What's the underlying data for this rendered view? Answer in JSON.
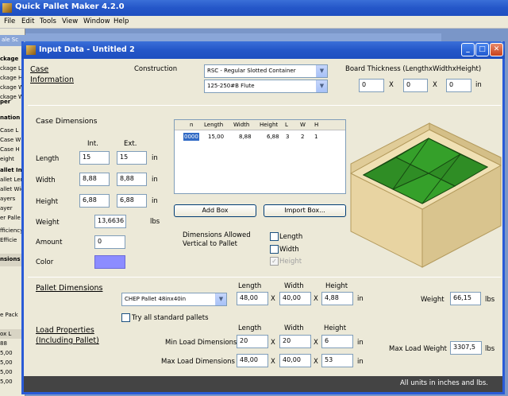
{
  "app": {
    "title": "Quick Pallet Maker 4.2.0",
    "menu": [
      "File",
      "Edit",
      "Tools",
      "View",
      "Window",
      "Help"
    ]
  },
  "bg": {
    "left_texts": [
      "ale Sc",
      "ckage",
      "ckage L",
      "ckage H",
      "ckage W",
      "ckage W",
      "per",
      "nation",
      "Case L",
      "Case W",
      "Case H",
      "eight",
      "allet Inf",
      "allet Len",
      "allet Wid",
      "ayers",
      "ayer",
      "er Palle",
      "fficiency",
      "Efficie",
      "nsions",
      "e Pack",
      "ox L",
      "88",
      "5,00",
      "5,00",
      "5,00",
      "5,00"
    ]
  },
  "dialog": {
    "title": "Input Data - Untitled 2",
    "case_info": {
      "label1": "Case",
      "label2": "Information",
      "construction_label": "Construction",
      "construction_value": "RSC - Regular Slotted Container",
      "flute_value": "125-250#B Flute",
      "board_label": "Board Thickness (LengthxWidthxHeight)",
      "board": [
        "0",
        "0",
        "0"
      ],
      "x": "X",
      "unit": "in"
    },
    "case_dim": {
      "title": "Case Dimensions",
      "int": "Int.",
      "ext": "Ext.",
      "length": "Length",
      "width": "Width",
      "height": "Height",
      "weight": "Weight",
      "amount": "Amount",
      "color": "Color",
      "len_int": "15",
      "len_ext": "15",
      "wid_int": "8,88",
      "wid_ext": "8,88",
      "hgt_int": "6,88",
      "hgt_ext": "6,88",
      "weight_val": "13,6636",
      "amount_val": "0",
      "in": "in",
      "lbs": "lbs"
    },
    "table": {
      "headers": [
        "n",
        "Length",
        "Width",
        "Height",
        "L",
        "W",
        "H"
      ],
      "row": [
        "0000",
        "15,00",
        "8,88",
        "6,88",
        "3",
        "2",
        "1"
      ]
    },
    "buttons": {
      "add": "Add Box",
      "import": "Import Box..."
    },
    "vertical": {
      "label1": "Dimensions Allowed",
      "label2": "Vertical to Pallet",
      "length": "Length",
      "width": "Width",
      "height": "Height",
      "check": "✓"
    },
    "pallet": {
      "label": "Pallet Dimensions",
      "value": "CHEP Pallet 48inx40in",
      "length_h": "Length",
      "width_h": "Width",
      "height_h": "Height",
      "length": "48,00",
      "width": "40,00",
      "height": "4,88",
      "x": "X",
      "in": "in",
      "weight_label": "Weight",
      "weight": "66,15",
      "lbs": "lbs",
      "try_all": "Try all standard pallets"
    },
    "load": {
      "label1": "Load Properties",
      "label2": "(Including Pallet)",
      "length_h": "Length",
      "width_h": "Width",
      "height_h": "Height",
      "min_label": "Min Load Dimensions",
      "max_label": "Max Load Dimensions",
      "min": [
        "20",
        "20",
        "6"
      ],
      "max": [
        "48,00",
        "40,00",
        "53"
      ],
      "x": "X",
      "in": "in",
      "max_weight_label": "Max Load Weight",
      "max_weight": "3307,5",
      "lbs": "lbs"
    },
    "footer": "All units in inches and lbs."
  },
  "colors": {
    "box_fill": "#e8d4a2",
    "box_side": "#d9c48e",
    "box_top": "#f0e0b4",
    "green_light": "#35a02a",
    "green_dark": "#2a7c20",
    "swatch": "#8c8cff"
  }
}
